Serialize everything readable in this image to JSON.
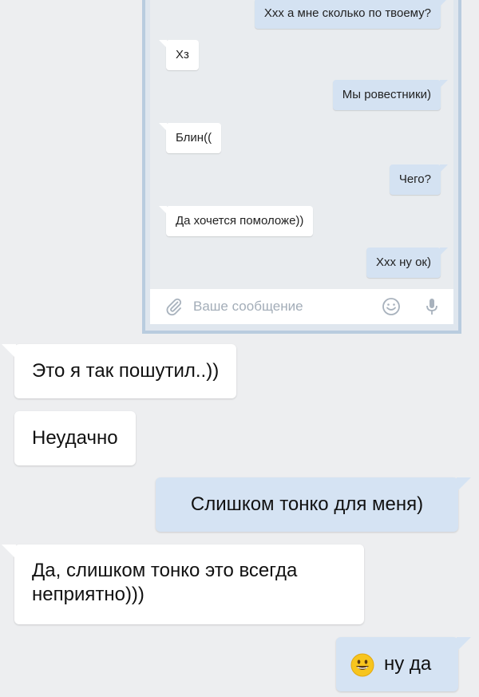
{
  "embedded_chat": {
    "messages": [
      {
        "text": "Ххх а мне сколько по твоему?",
        "side": "out"
      },
      {
        "text": "Хз",
        "side": "in"
      },
      {
        "text": "Мы ровестники)",
        "side": "out"
      },
      {
        "text": "Блин((",
        "side": "in"
      },
      {
        "text": "Чего?",
        "side": "out"
      },
      {
        "text": "Да хочется помоложе))",
        "side": "in"
      },
      {
        "text": "Ххх ну ок)",
        "side": "out"
      }
    ],
    "input_placeholder": "Ваше сообщение",
    "icons": [
      "paperclip-icon",
      "smile-icon",
      "microphone-icon"
    ]
  },
  "chat": {
    "messages": [
      {
        "text": "Это я так пошутил..))",
        "side": "in"
      },
      {
        "text": "Неудачно",
        "side": "in"
      },
      {
        "text": "Слишком тонко для меня)",
        "side": "out"
      },
      {
        "line1": "Да, слишком тонко это всегда",
        "line2": "неприятно)))",
        "side": "in"
      },
      {
        "text": "ну да",
        "emoji": "grinning-face-emoji",
        "side": "out"
      }
    ]
  },
  "colors": {
    "background": "#edeef0",
    "incoming_bubble": "#ffffff",
    "outgoing_bubble": "#d5e3f3",
    "embed_border": "#b9ccdf"
  }
}
